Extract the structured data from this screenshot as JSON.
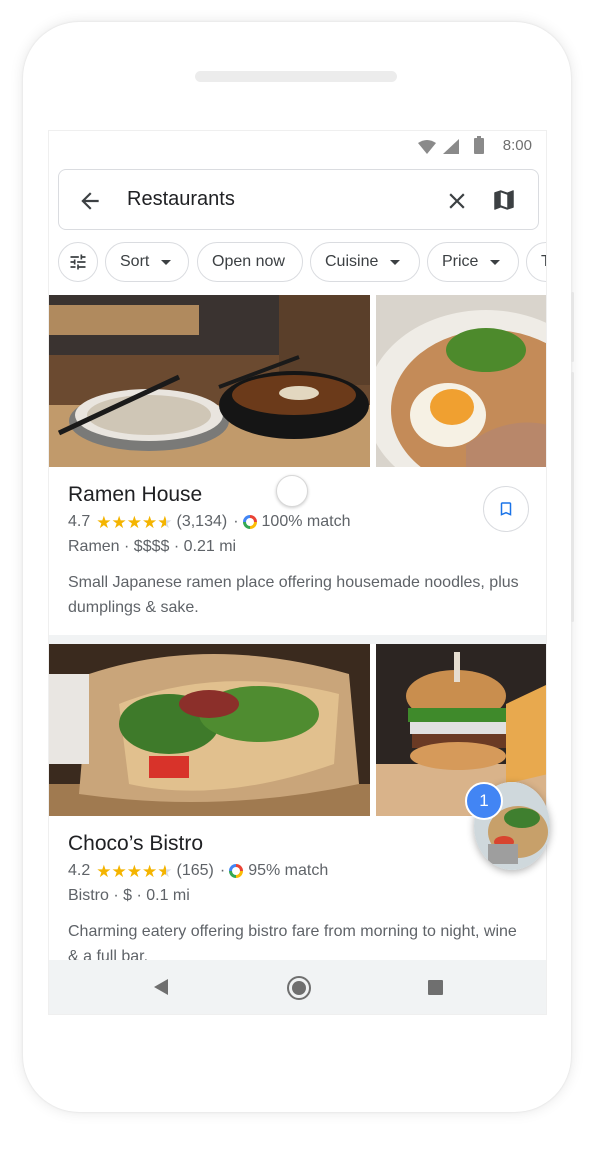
{
  "status": {
    "time": "8:00"
  },
  "search": {
    "title": "Restaurants"
  },
  "chips": [
    "Sort",
    "Open now",
    "Cuisine",
    "Price",
    "T"
  ],
  "results": [
    {
      "name": "Ramen House",
      "rating": "4.7",
      "reviews": "(3,134)",
      "match": "100% match",
      "meta": "Ramen · $$$$ · 0.21 mi",
      "description": "Small Japanese ramen place offering housemade noodles, plus dumplings & sake."
    },
    {
      "name": "Choco’s Bistro",
      "rating": "4.2",
      "reviews": "(165)",
      "match": "95% match",
      "meta": "Bistro · $ · 0.1 mi",
      "description": "Charming eatery offering bistro fare from morning to night, wine & a full bar."
    }
  ],
  "chat_head": {
    "badge": "1"
  },
  "colors": {
    "accent": "#4285f4",
    "star": "#f4b400",
    "text_secondary": "#5f6368"
  },
  "icons": [
    "back-arrow-icon",
    "close-icon",
    "map-icon",
    "filter-icon",
    "bookmark-icon",
    "wifi-icon",
    "signal-icon",
    "battery-icon"
  ]
}
